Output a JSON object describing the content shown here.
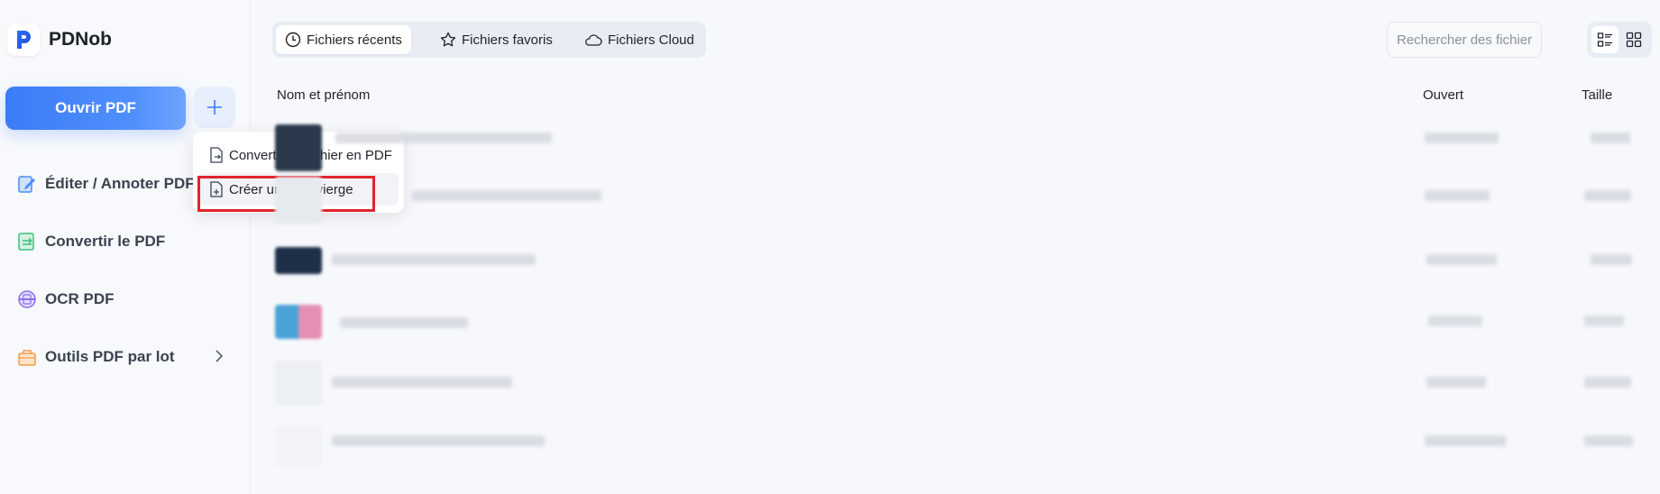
{
  "app": {
    "name": "PDNob"
  },
  "sidebar": {
    "open_button": "Ouvrir PDF",
    "items": [
      {
        "label": "Éditer / Annoter PDF",
        "icon": "edit-annotate-icon",
        "color": "#4a8cf7"
      },
      {
        "label": "Convertir le PDF",
        "icon": "convert-icon",
        "color": "#3cbf7a"
      },
      {
        "label": "OCR PDF",
        "icon": "ocr-icon",
        "color": "#8b6cf0"
      },
      {
        "label": "Outils PDF par lot",
        "icon": "batch-tools-icon",
        "color": "#f39b4a"
      }
    ]
  },
  "dropdown": {
    "items": [
      {
        "label": "Convertir un fichier en PDF",
        "icon": "file-convert-icon"
      },
      {
        "label": "Créer un PDF vierge",
        "icon": "file-new-icon"
      }
    ]
  },
  "tabs": [
    {
      "label": "Fichiers récents",
      "icon": "clock-icon",
      "active": true
    },
    {
      "label": "Fichiers favoris",
      "icon": "star-icon",
      "active": false
    },
    {
      "label": "Fichiers Cloud",
      "icon": "cloud-icon",
      "active": false
    }
  ],
  "search": {
    "placeholder": "Rechercher des fichiers"
  },
  "table": {
    "columns": {
      "name": "Nom et prénom",
      "opened": "Ouvert",
      "size": "Taille"
    }
  },
  "colors": {
    "accent": "#3c7cf8",
    "highlight": "#e0242c"
  }
}
